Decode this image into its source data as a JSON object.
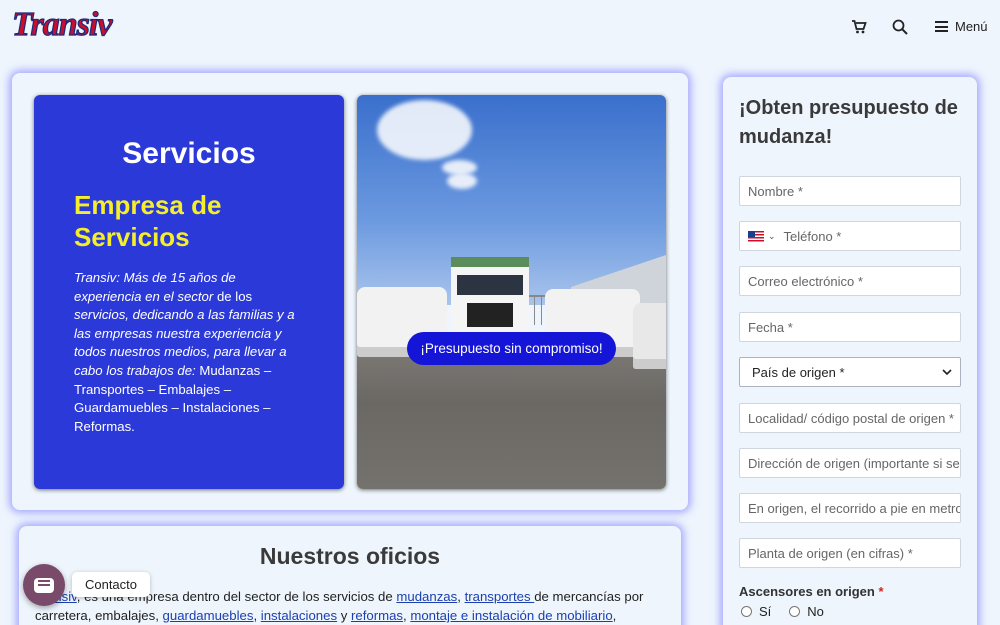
{
  "header": {
    "logo_text": "Transiv",
    "cart_icon": "cart-icon",
    "search_icon": "search-icon",
    "menu_label": "Menú"
  },
  "hero": {
    "title": "Servicios",
    "subtitle": "Empresa de Servicios",
    "description_italic": "Transiv: Más de 15 años de experiencia en el sector",
    "description_1": " de los ",
    "description_italic_2": "servicios, dedicando a las familias y a las empresas nuestra experiencia y todos nuestros medios, para llevar a cabo los trabajos de:",
    "description_2": " Mudanzas – Transportes – Embalajes – Guardamuebles – Instalaciones – Reformas.",
    "cta_label": "¡Presupuesto sin compromiso!",
    "colors": {
      "panel": "#2b39d9",
      "subtitle": "#f4ef2a",
      "cta": "#1515d8"
    }
  },
  "oficios": {
    "title": "Nuestros oficios",
    "p_start": "Transiv",
    "p_1": ", es una empresa dentro del sector de los servicios de ",
    "link_mudanzas": "mudanzas",
    "p_2": ", ",
    "link_transportes": "transportes ",
    "p_3": "de mercancías por carretera, embalajes, ",
    "link_guardamuebles": "guardamuebles",
    "p_4": ", ",
    "link_instalaciones": "instalaciones",
    "p_5": " y ",
    "link_reformas": "reformas",
    "p_6": ", ",
    "link_montaje": "montaje e instalación de mobiliario",
    "p_7": ","
  },
  "contact_widget": {
    "label": "Contacto"
  },
  "form": {
    "title": "¡Obten presupuesto de mudanza!",
    "nombre_placeholder": "Nombre *",
    "telefono_placeholder": "Teléfono *",
    "email_placeholder": "Correo electrónico *",
    "fecha_placeholder": "Fecha *",
    "pais_selected": "País de origen *",
    "localidad_placeholder": "Localidad/ código postal de origen *",
    "direccion_placeholder": "Dirección de origen (importante si se",
    "recorrido_placeholder": "En origen, el recorrido a pie en metros",
    "planta_placeholder": "Planta de origen (en cifras) *",
    "ascensores_label": "Ascensores en origen",
    "required_mark": "*",
    "option_si": "Sí",
    "option_no": "No"
  }
}
